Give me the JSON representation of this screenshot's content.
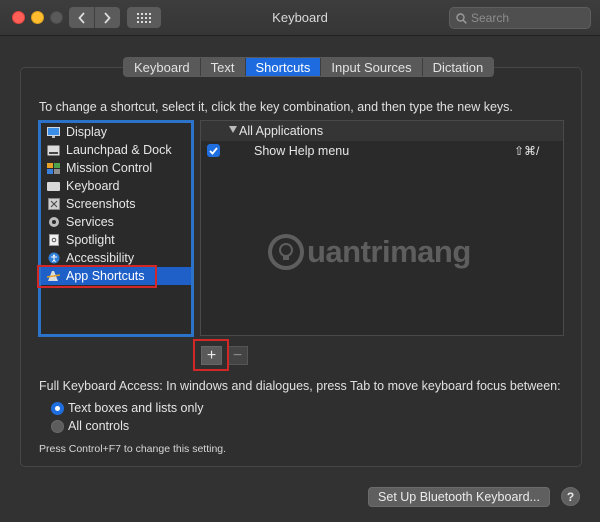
{
  "window": {
    "title": "Keyboard",
    "search_placeholder": "Search"
  },
  "tabs": [
    {
      "label": "Keyboard",
      "active": false
    },
    {
      "label": "Text",
      "active": false
    },
    {
      "label": "Shortcuts",
      "active": true
    },
    {
      "label": "Input Sources",
      "active": false
    },
    {
      "label": "Dictation",
      "active": false
    }
  ],
  "instruction": "To change a shortcut, select it, click the key combination, and then type the new keys.",
  "categories": [
    {
      "label": "Display",
      "icon": "display-icon"
    },
    {
      "label": "Launchpad & Dock",
      "icon": "launchpad-icon"
    },
    {
      "label": "Mission Control",
      "icon": "mission-control-icon"
    },
    {
      "label": "Keyboard",
      "icon": "keyboard-icon"
    },
    {
      "label": "Screenshots",
      "icon": "screenshot-icon"
    },
    {
      "label": "Services",
      "icon": "gear-icon"
    },
    {
      "label": "Spotlight",
      "icon": "document-icon"
    },
    {
      "label": "Accessibility",
      "icon": "accessibility-icon"
    },
    {
      "label": "App Shortcuts",
      "icon": "app-shortcuts-icon",
      "selected": true
    }
  ],
  "shortcuts": {
    "group_label": "All Applications",
    "rows": [
      {
        "checked": true,
        "command": "Show Help menu",
        "keys": "⇧⌘/"
      }
    ]
  },
  "watermark": "uantrimang",
  "buttons": {
    "add": "+",
    "remove": "−",
    "bluetooth": "Set Up Bluetooth Keyboard...",
    "help": "?"
  },
  "full_keyboard_access": {
    "label": "Full Keyboard Access: In windows and dialogues, press Tab to move keyboard focus between:",
    "options": [
      {
        "label": "Text boxes and lists only",
        "selected": true
      },
      {
        "label": "All controls",
        "selected": false
      }
    ],
    "note": "Press Control+F7 to change this setting."
  },
  "colors": {
    "accent": "#1e6be0",
    "highlight_red": "#d32626"
  }
}
